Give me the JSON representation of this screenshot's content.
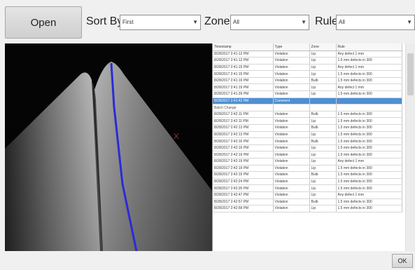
{
  "toolbar": {
    "open_label": "Open",
    "sort_label": "Sort By",
    "sort_value": "First",
    "zone_label": "Zone",
    "zone_value": "All",
    "rule_label": "Rule",
    "rule_value": "All"
  },
  "table": {
    "columns": [
      "Timestamp",
      "Type",
      "Zone",
      "Rule"
    ],
    "rows": [
      {
        "timestamp": "8/28/2017 2:41:12 PM",
        "type": "Violation",
        "zone": "Lip",
        "rule": "Any defect 1 mm"
      },
      {
        "timestamp": "8/28/2017 2:41:12 PM",
        "type": "Violation",
        "zone": "Lip",
        "rule": "1.5 mm defects in 300"
      },
      {
        "timestamp": "8/28/2017 2:41:15 PM",
        "type": "Violation",
        "zone": "Lip",
        "rule": "Any defect 1 mm"
      },
      {
        "timestamp": "8/28/2017 2:41:15 PM",
        "type": "Violation",
        "zone": "Lip",
        "rule": "1.5 mm defects in 300"
      },
      {
        "timestamp": "8/28/2017 2:41:19 PM",
        "type": "Violation",
        "zone": "Bulb",
        "rule": "1.5 mm defects in 300"
      },
      {
        "timestamp": "8/28/2017 2:41:19 PM",
        "type": "Violation",
        "zone": "Lip",
        "rule": "Any defect 1 mm"
      },
      {
        "timestamp": "8/28/2017 2:41:39 PM",
        "type": "Violation",
        "zone": "Lip",
        "rule": "1.5 mm defects in 300"
      },
      {
        "timestamp": "8/28/2017 2:41:42 PM",
        "type": "Comment",
        "zone": "",
        "rule": "",
        "selected": true
      },
      {
        "timestamp": "Batch Change",
        "type": "",
        "zone": "",
        "rule": "",
        "group": true
      },
      {
        "timestamp": "8/28/2017 2:42:11 PM",
        "type": "Violation",
        "zone": "Bulb",
        "rule": "1.5 mm defects in 300"
      },
      {
        "timestamp": "8/28/2017 2:42:11 PM",
        "type": "Violation",
        "zone": "Lip",
        "rule": "1.5 mm defects in 300"
      },
      {
        "timestamp": "8/28/2017 2:42:13 PM",
        "type": "Violation",
        "zone": "Bulb",
        "rule": "1.5 mm defects in 300"
      },
      {
        "timestamp": "8/28/2017 2:42:13 PM",
        "type": "Violation",
        "zone": "Lip",
        "rule": "1.5 mm defects in 300"
      },
      {
        "timestamp": "8/28/2017 2:42:16 PM",
        "type": "Violation",
        "zone": "Bulb",
        "rule": "1.5 mm defects in 300"
      },
      {
        "timestamp": "8/28/2017 2:42:16 PM",
        "type": "Violation",
        "zone": "Lip",
        "rule": "1.5 mm defects in 300"
      },
      {
        "timestamp": "8/28/2017 2:42:19 PM",
        "type": "Violation",
        "zone": "Lip",
        "rule": "1.5 mm defects in 300"
      },
      {
        "timestamp": "8/28/2017 2:42:19 PM",
        "type": "Violation",
        "zone": "Lip",
        "rule": "Any defect 1 mm"
      },
      {
        "timestamp": "8/28/2017 2:42:19 PM",
        "type": "Violation",
        "zone": "Lip",
        "rule": "1.5 mm defects in 300"
      },
      {
        "timestamp": "8/28/2017 2:42:19 PM",
        "type": "Violation",
        "zone": "Bulb",
        "rule": "1.5 mm defects in 300"
      },
      {
        "timestamp": "8/28/2017 2:42:24 PM",
        "type": "Violation",
        "zone": "Lip",
        "rule": "1.5 mm defects in 300"
      },
      {
        "timestamp": "8/28/2017 2:42:35 PM",
        "type": "Violation",
        "zone": "Lip",
        "rule": "1.5 mm defects in 300"
      },
      {
        "timestamp": "8/28/2017 2:42:47 PM",
        "type": "Violation",
        "zone": "Lip",
        "rule": "Any defect 1 mm"
      },
      {
        "timestamp": "8/28/2017 2:42:57 PM",
        "type": "Violation",
        "zone": "Bulb",
        "rule": "1.5 mm defects in 300"
      },
      {
        "timestamp": "8/28/2017 2:42:58 PM",
        "type": "Violation",
        "zone": "Lip",
        "rule": "1.5 mm defects in 300"
      }
    ]
  },
  "footer": {
    "ok_label": "OK"
  },
  "colors": {
    "selection": "#4e8fd4",
    "scan_line": "#2b2bd6",
    "viewport_bg": "#050505"
  }
}
